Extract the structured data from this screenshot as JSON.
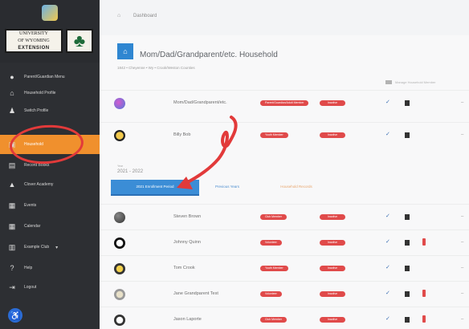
{
  "sidebar": {
    "brand": {
      "line1": "UNIVERSITY",
      "line2": "OF WYOMING",
      "ext": "EXTENSION"
    },
    "items": [
      {
        "label": "Parent/Guardian Menu",
        "icon": "avatar-icon"
      },
      {
        "label": "Household Profile",
        "icon": "home-icon"
      },
      {
        "label": "Switch Profile",
        "icon": "user-icon"
      },
      {
        "label": "Household",
        "icon": "household-icon",
        "active": true
      },
      {
        "label": "Record Books",
        "icon": "book-icon"
      },
      {
        "label": "Clover Academy",
        "icon": "graduation-cap-icon"
      },
      {
        "label": "Events",
        "icon": "calendar-icon"
      },
      {
        "label": "Calendar",
        "icon": "calendar-icon"
      },
      {
        "label": "Example Club",
        "icon": "club-icon"
      },
      {
        "label": "Help",
        "icon": "help-icon"
      },
      {
        "label": "Logout",
        "icon": "logout-icon"
      }
    ]
  },
  "topbar": {
    "breadcrumb": "Dashboard"
  },
  "household": {
    "title": "Mom/Dad/Grandparent/etc. Household",
    "subtitle": "1842 • Cheyenne • Wy • Crook/Weston Counties",
    "column_header": "Manage Household Member"
  },
  "adult_rows": [
    {
      "name": "Mom/Dad/Grandparent/etc.",
      "badge1": "Parent/Guardian/Adult Member",
      "badge2": "Inactive"
    },
    {
      "name": "Billy Bob",
      "badge1": "Youth Member",
      "badge2": "Inactive"
    }
  ],
  "year": {
    "label": "Year",
    "value": "2021 - 2022"
  },
  "tabs": [
    {
      "label": "2021 Enrollment Period"
    },
    {
      "label": "Previous Years"
    },
    {
      "label": "Household Records"
    }
  ],
  "member_rows": [
    {
      "name": "Steven Brown",
      "badge1": "Club Member",
      "badge2": "Inactive"
    },
    {
      "name": "Johnny Quinn",
      "badge1": "Volunteer",
      "badge2": "Inactive"
    },
    {
      "name": "Tom Crook",
      "badge1": "Youth Member",
      "badge2": "Inactive"
    },
    {
      "name": "Jane Grandparent Test",
      "badge1": "Volunteer",
      "badge2": "Inactive"
    },
    {
      "name": "Jason Laporte",
      "badge1": "Club Member",
      "badge2": "Inactive"
    }
  ],
  "colors": {
    "sidebar": "#2d2f33",
    "active": "#f0902d",
    "primary": "#3b8dd6",
    "badge": "#e04a4a",
    "annotation": "#e23a3a"
  }
}
